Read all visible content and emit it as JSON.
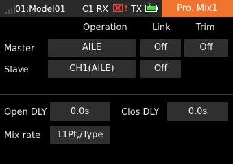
{
  "status": {
    "model": "01:Model01",
    "rx_label": "C1 RX",
    "rx_alert": "!",
    "tx_label": "TX",
    "title": "Pro. Mix1"
  },
  "header": {
    "operation": "Operation",
    "link": "Link",
    "trim": "Trim"
  },
  "master": {
    "label": "Master",
    "operation": "AILE",
    "link": "Off",
    "trim": "Off"
  },
  "slave": {
    "label": "Slave",
    "operation": "CH1(AILE)",
    "link": "Off"
  },
  "delays": {
    "open_label": "Open DLY",
    "open_value": "0.0s",
    "close_label": "Clos DLY",
    "close_value": "0.0s"
  },
  "mix_rate": {
    "label": "Mix rate",
    "value": "11Pt,/Type"
  }
}
